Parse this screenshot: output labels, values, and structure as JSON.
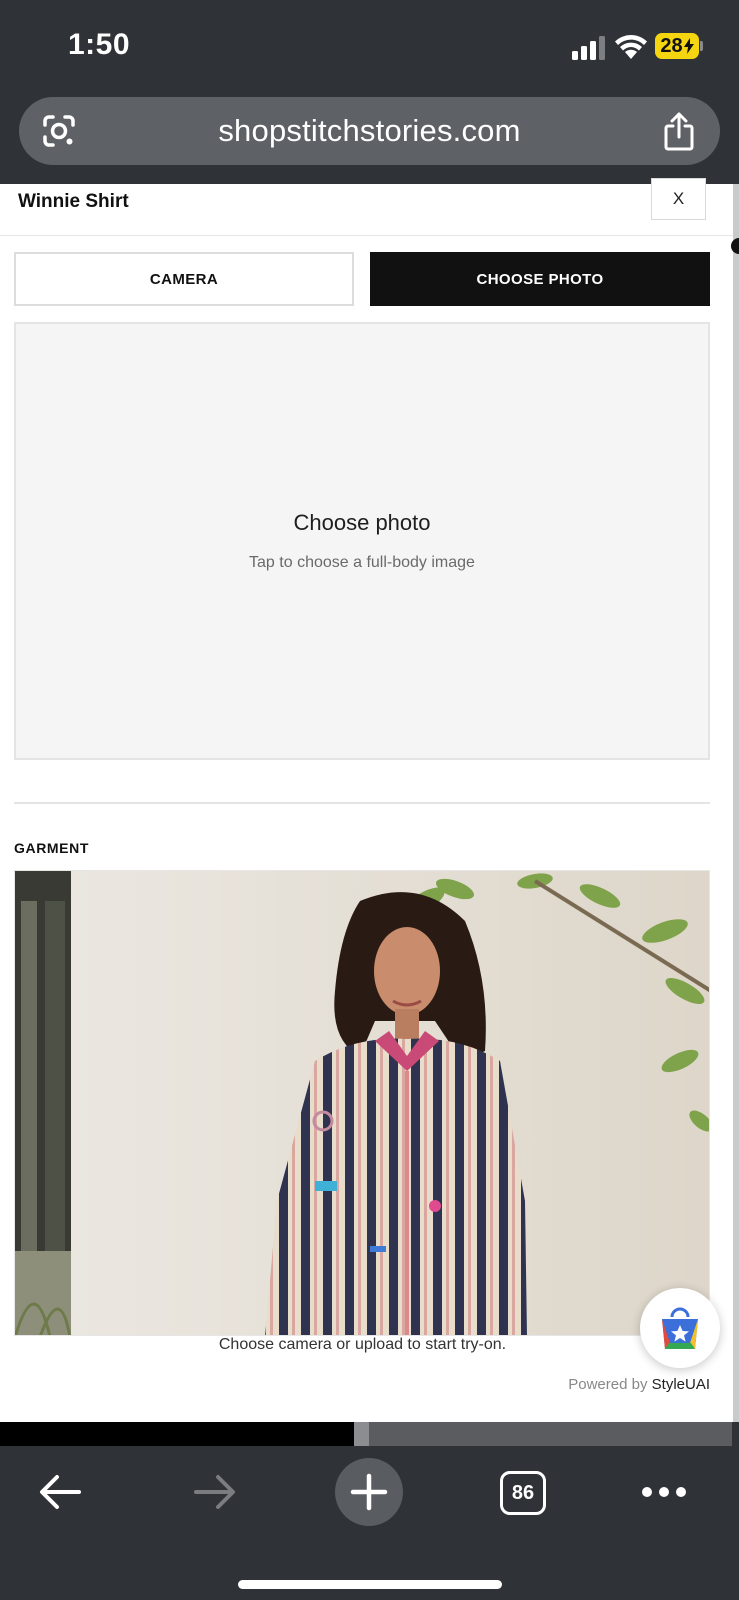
{
  "status_bar": {
    "time": "1:50",
    "battery_level": "28",
    "icons": [
      "signal-icon",
      "wifi-icon",
      "battery-charging-icon"
    ]
  },
  "browser": {
    "url": "shopstitchstories.com",
    "icons": [
      "google-lens-icon",
      "share-icon"
    ],
    "tab_count": "86",
    "toolbar_icons": [
      "back-arrow-icon",
      "forward-arrow-icon",
      "new-tab-plus-icon",
      "tab-switcher-icon",
      "more-dots-icon"
    ]
  },
  "modal": {
    "title": "Winnie Shirt",
    "close_label": "X",
    "tabs": [
      {
        "label": "CAMERA",
        "active": false
      },
      {
        "label": "CHOOSE PHOTO",
        "active": true
      }
    ],
    "upload": {
      "title": "Choose photo",
      "subtitle": "Tap to choose a full-body image"
    },
    "garment_label": "GARMENT",
    "hint": "Choose camera or upload to start try-on.",
    "powered_prefix": "Powered by",
    "powered_brand": "StyleUAI",
    "fab_icon": "shopping-bag-star-icon"
  },
  "colors": {
    "browser_chrome": "#2f3236",
    "url_pill": "#5e6165",
    "active_tab": "#111111",
    "battery": "#f5d50f"
  }
}
